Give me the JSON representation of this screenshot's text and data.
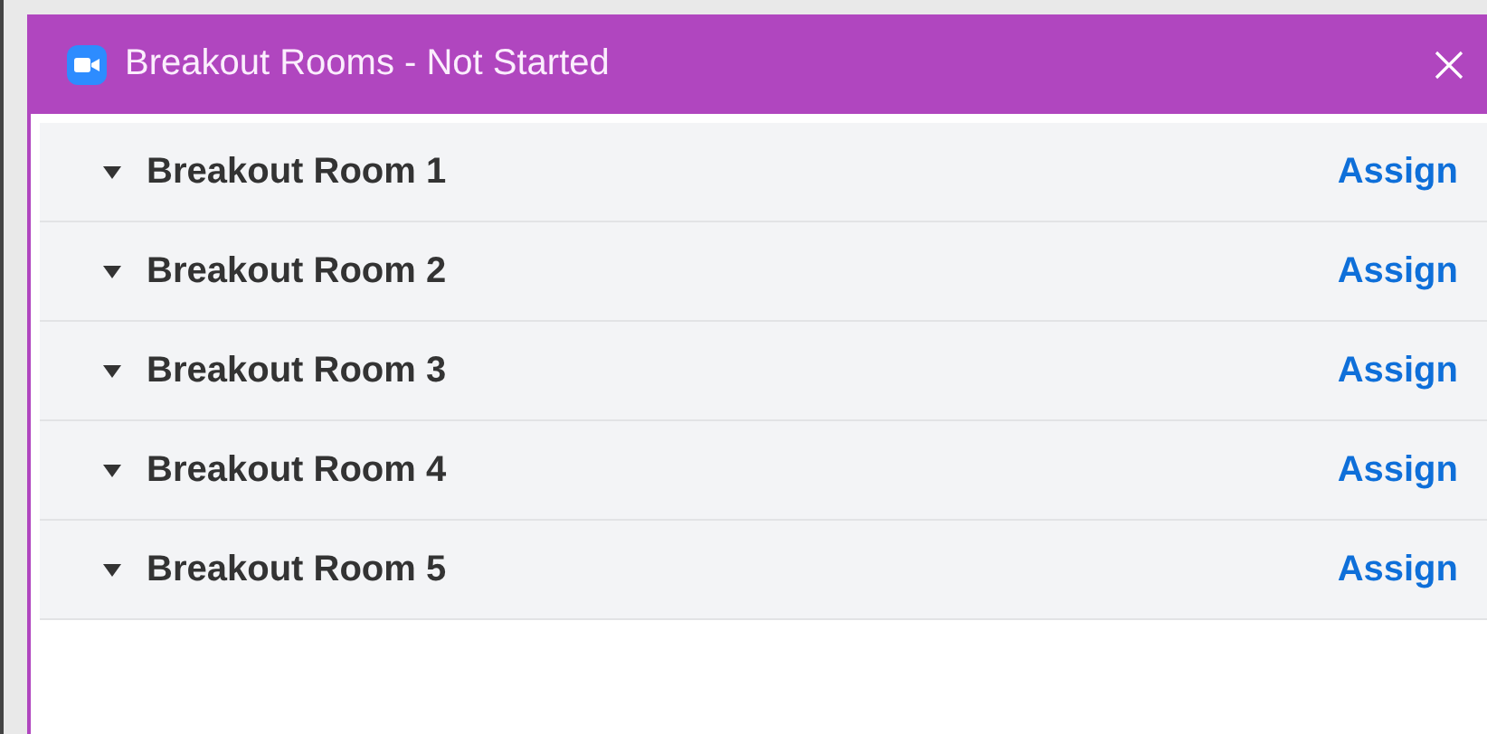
{
  "window": {
    "title": "Breakout Rooms - Not Started"
  },
  "rooms": [
    {
      "name": "Breakout Room 1",
      "action": "Assign"
    },
    {
      "name": "Breakout Room 2",
      "action": "Assign"
    },
    {
      "name": "Breakout Room 3",
      "action": "Assign"
    },
    {
      "name": "Breakout Room 4",
      "action": "Assign"
    },
    {
      "name": "Breakout Room 5",
      "action": "Assign"
    }
  ]
}
